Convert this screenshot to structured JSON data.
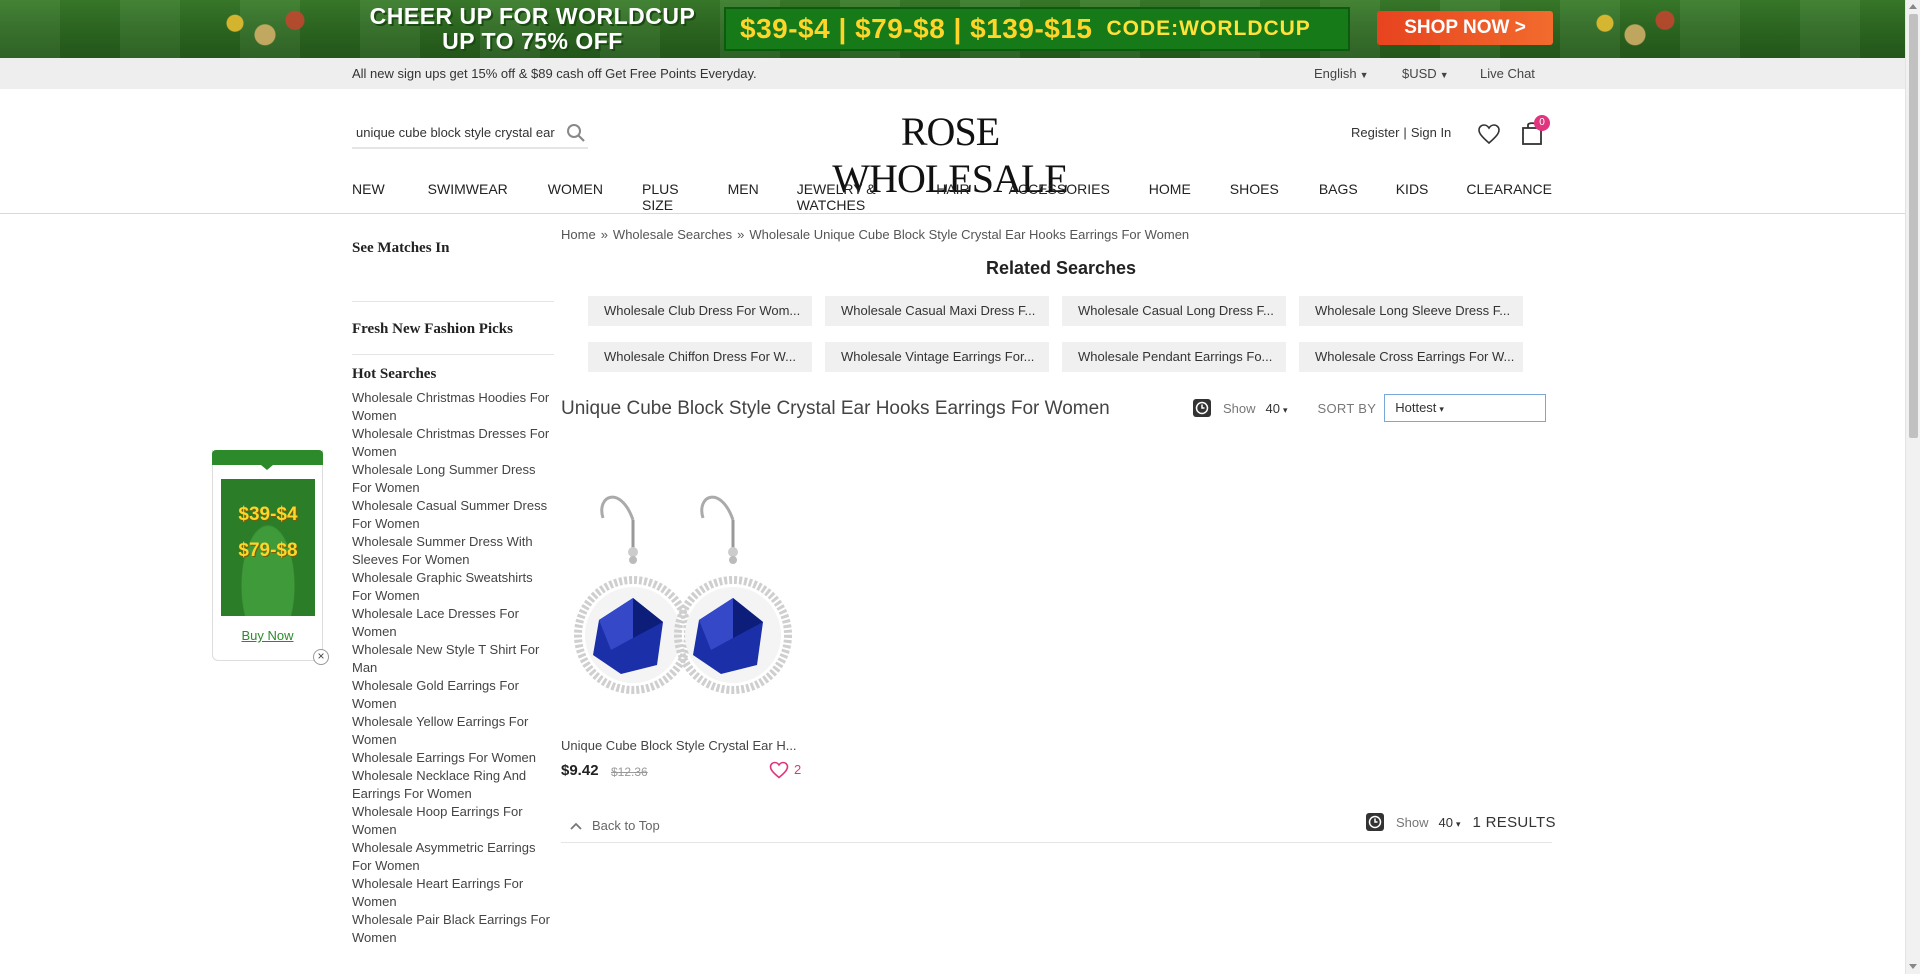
{
  "banner": {
    "headline_line1": "CHEER UP FOR WORLDCUP",
    "headline_line2": "UP TO 75% OFF",
    "deals": "$39-$4 | $79-$8 | $139-$15",
    "code": "CODE:WORLDCUP",
    "cta": "SHOP NOW >"
  },
  "infobar": {
    "promo": "All new sign ups get 15% off & $89 cash off  Get Free Points Everyday.",
    "language": "English",
    "currency": "$USD",
    "live_chat": "Live Chat"
  },
  "header": {
    "search_value": "unique cube block style crystal ear",
    "logo": "ROSE WHOLESALE",
    "register": "Register",
    "separator": "|",
    "sign_in": "Sign In",
    "cart_count": "0"
  },
  "nav": [
    "NEW",
    "SWIMWEAR",
    "WOMEN",
    "PLUS SIZE",
    "MEN",
    "JEWELRY & WATCHES",
    "HAIR",
    "ACCESSORIES",
    "HOME",
    "SHOES",
    "BAGS",
    "KIDS",
    "CLEARANCE"
  ],
  "sidebar": {
    "see_matches": "See Matches In",
    "fresh": "Fresh New Fashion Picks",
    "hot_searches_title": "Hot Searches",
    "hot_searches": [
      "Wholesale Christmas Hoodies For Women",
      "Wholesale Christmas Dresses For Women",
      "Wholesale Long Summer Dress For Women",
      "Wholesale Casual Summer Dress For Women",
      "Wholesale Summer Dress With Sleeves For Women",
      "Wholesale Graphic Sweatshirts For Women",
      "Wholesale Lace Dresses For Women",
      "Wholesale New Style T Shirt For Man",
      "Wholesale Gold Earrings For Women",
      "Wholesale Yellow Earrings For Women",
      "Wholesale Earrings For Women",
      "Wholesale Necklace Ring And Earrings For Women",
      "Wholesale Hoop Earrings For Women",
      "Wholesale Asymmetric Earrings For Women",
      "Wholesale Heart Earrings For Women",
      "Wholesale Pair Black Earrings For Women"
    ]
  },
  "float_promo": {
    "line1": "$39-$4",
    "line2": "$79-$8",
    "buy_now": "Buy Now",
    "close": "×"
  },
  "breadcrumb": [
    "Home",
    "Wholesale Searches",
    "Wholesale Unique Cube Block Style Crystal Ear Hooks Earrings For Women"
  ],
  "breadcrumb_sep": "»",
  "related": {
    "title": "Related Searches",
    "items": [
      "Wholesale Club Dress For Wom...",
      "Wholesale Casual Maxi Dress F...",
      "Wholesale Casual Long Dress F...",
      "Wholesale Long Sleeve Dress F...",
      "Wholesale Chiffon Dress For W...",
      "Wholesale Vintage Earrings For...",
      "Wholesale Pendant Earrings Fo...",
      "Wholesale Cross Earrings For W..."
    ]
  },
  "results": {
    "title": "Unique Cube Block Style Crystal Ear Hooks Earrings For Women",
    "show_label": "Show",
    "show_value": "40",
    "sort_label": "SORT BY",
    "sort_value": "Hottest",
    "count": "1 RESULTS",
    "back_to_top": "Back to Top"
  },
  "product": {
    "name": "Unique Cube Block Style Crystal Ear H...",
    "price": "$9.42",
    "old_price": "$12.36",
    "favorites": "2"
  },
  "colors": {
    "accent_pink": "#e0357e",
    "banner_green": "#2d8a2b",
    "sapphire": "#1a2fa8"
  }
}
